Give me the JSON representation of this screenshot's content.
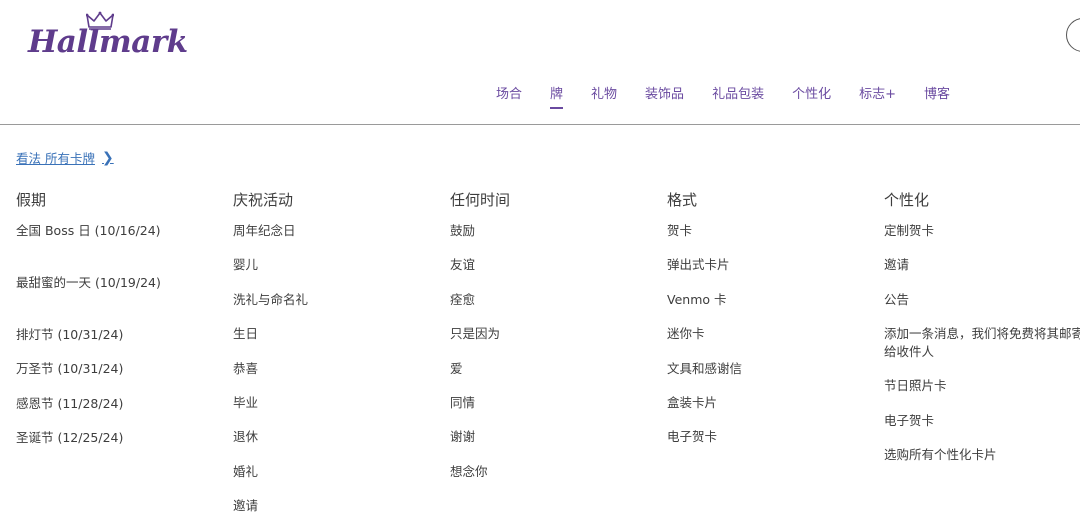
{
  "brand": {
    "name": "Hallmark"
  },
  "nav": {
    "items": [
      {
        "label": "场合",
        "active": false
      },
      {
        "label": "牌",
        "active": true
      },
      {
        "label": "礼物",
        "active": false
      },
      {
        "label": "装饰品",
        "active": false
      },
      {
        "label": "礼品包装",
        "active": false
      },
      {
        "label": "个性化",
        "active": false
      },
      {
        "label": "标志+",
        "active": false
      },
      {
        "label": "博客",
        "active": false
      }
    ]
  },
  "see_all": {
    "label": "看法 所有卡牌"
  },
  "columns": [
    {
      "heading": "假期",
      "items": [
        "全国 Boss 日 (10/16/24)",
        "最甜蜜的一天 (10/19/24)",
        "排灯节 (10/31/24)",
        "万圣节 (10/31/24)",
        "感恩节 (11/28/24)",
        "圣诞节 (12/25/24)"
      ]
    },
    {
      "heading": "庆祝活动",
      "items": [
        "周年纪念日",
        "婴儿",
        "洗礼与命名礼",
        "生日",
        "恭喜",
        "毕业",
        "退休",
        "婚礼",
        "邀请"
      ]
    },
    {
      "heading": "任何时间",
      "items": [
        "鼓励",
        "友谊",
        "痊愈",
        "只是因为",
        "爱",
        "同情",
        "谢谢",
        "想念你"
      ]
    },
    {
      "heading": "格式",
      "items": [
        "贺卡",
        "弹出式卡片",
        "Venmo 卡",
        "迷你卡",
        "文具和感谢信",
        "盒装卡片",
        "电子贺卡"
      ]
    },
    {
      "heading": "个性化",
      "items": [
        "定制贺卡",
        "邀请",
        "公告",
        "添加一条消息，我们将免费将其邮寄给收件人",
        "节日照片卡",
        "电子贺卡",
        "选购所有个性化卡片"
      ]
    }
  ],
  "colors": {
    "brand_purple": "#5f3c8c",
    "nav_purple": "#6a4aa0",
    "link_blue": "#3a72b8"
  }
}
